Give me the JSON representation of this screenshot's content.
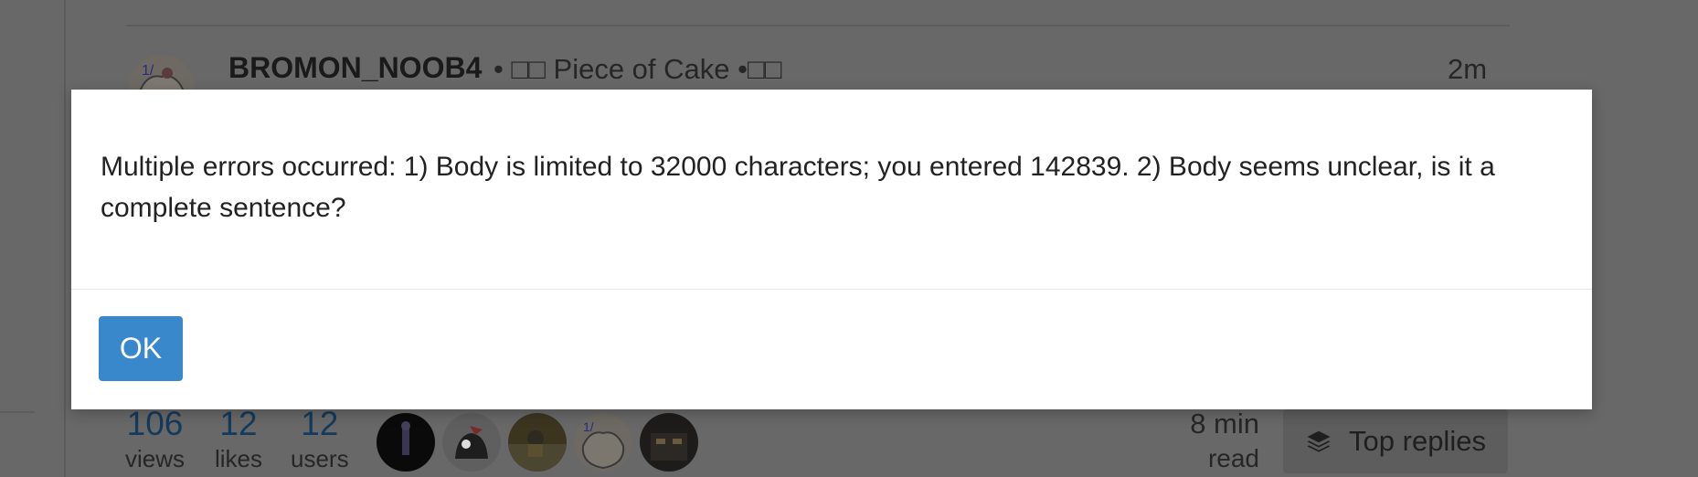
{
  "post": {
    "username": "BROMON_NOOB4",
    "meta": "• □□ Piece of Cake •□□",
    "time": "2m"
  },
  "topic_stats": {
    "views": {
      "count": "106",
      "label": "views"
    },
    "likes": {
      "count": "12",
      "label": "likes"
    },
    "users": {
      "count": "12",
      "label": "users"
    }
  },
  "participants": [
    "avatar-user-1",
    "avatar-user-2",
    "avatar-user-3",
    "avatar-user-4",
    "avatar-user-5"
  ],
  "read_time": {
    "value": "8 min",
    "unit": "read"
  },
  "top_replies": {
    "label": "Top replies",
    "icon": "layers-icon"
  },
  "modal": {
    "message": "Multiple errors occurred: 1) Body is limited to 32000 characters; you entered 142839. 2) Body seems unclear, is it a complete sentence?",
    "ok_label": "OK",
    "accent": "#3a88cc"
  }
}
